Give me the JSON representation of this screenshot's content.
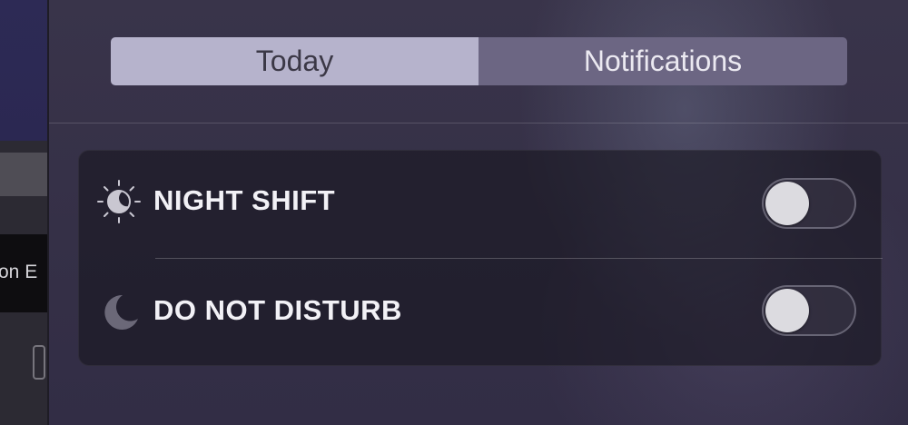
{
  "background_window": {
    "partial_text_top": "",
    "partial_text_bottom": "on E"
  },
  "notification_center": {
    "tabs": [
      {
        "label": "Today",
        "selected": true
      },
      {
        "label": "Notifications",
        "selected": false
      }
    ],
    "controls": [
      {
        "label": "NIGHT SHIFT",
        "icon": "night-shift-icon",
        "on": false
      },
      {
        "label": "DO NOT DISTURB",
        "icon": "moon-icon",
        "on": false
      }
    ]
  },
  "colors": {
    "tab_selected_bg": "#b6b3cc",
    "tab_unselected_bg": "#6c6683",
    "card_bg": "#1f1c28",
    "toggle_knob": "#dcdbe0"
  }
}
